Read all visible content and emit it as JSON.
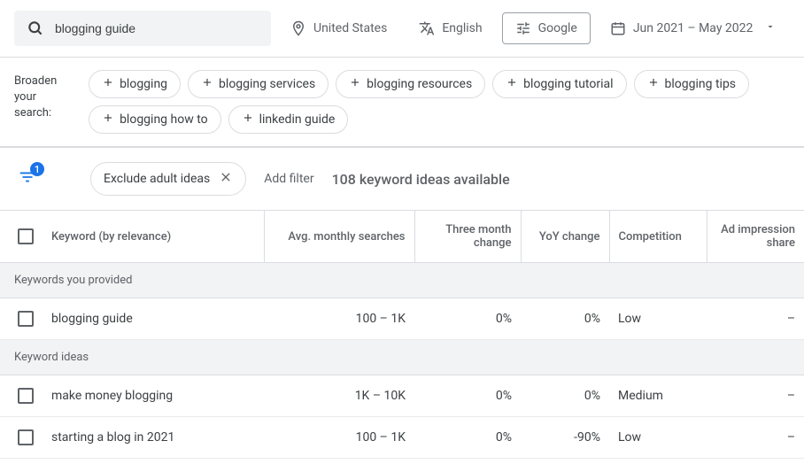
{
  "search": {
    "query": "blogging guide"
  },
  "topbar": {
    "location": "United States",
    "language": "English",
    "network": "Google",
    "daterange": "Jun 2021 – May 2022"
  },
  "broaden": {
    "label": "Broaden your search:",
    "pills": [
      "blogging",
      "blogging services",
      "blogging resources",
      "blogging tutorial",
      "blogging tips",
      "blogging how to",
      "linkedin guide"
    ]
  },
  "filters": {
    "badge": "1",
    "active_filter": "Exclude adult ideas",
    "add_filter": "Add filter",
    "count_text": "108 keyword ideas available"
  },
  "table": {
    "headers": {
      "keyword": "Keyword (by relevance)",
      "avg": "Avg. monthly searches",
      "three": "Three month change",
      "yoy": "YoY change",
      "comp": "Competition",
      "adimp": "Ad impression share"
    },
    "section_provided": "Keywords you provided",
    "section_ideas": "Keyword ideas",
    "rows_provided": [
      {
        "keyword": "blogging guide",
        "avg": "100 – 1K",
        "three": "0%",
        "yoy": "0%",
        "comp": "Low",
        "adimp": "–"
      }
    ],
    "rows_ideas": [
      {
        "keyword": "make money blogging",
        "avg": "1K – 10K",
        "three": "0%",
        "yoy": "0%",
        "comp": "Medium",
        "adimp": "–"
      },
      {
        "keyword": "starting a blog in 2021",
        "avg": "100 – 1K",
        "three": "0%",
        "yoy": "-90%",
        "comp": "Low",
        "adimp": "–"
      }
    ]
  }
}
